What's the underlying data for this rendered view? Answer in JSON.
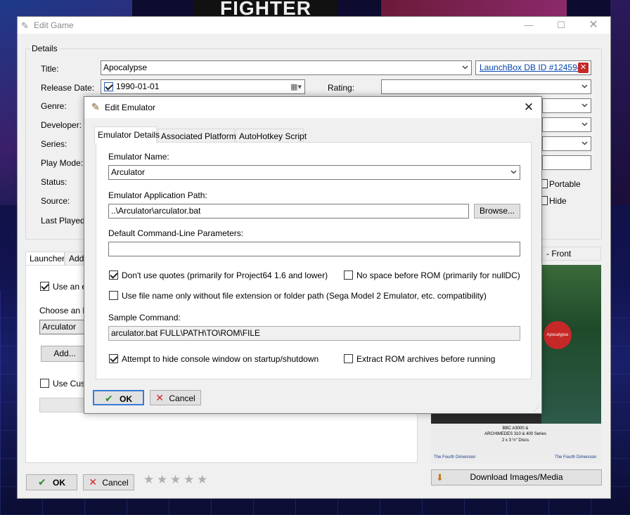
{
  "background": {
    "banner_text": "FIGHTER"
  },
  "edit_game": {
    "title": "Edit Game",
    "details_legend": "Details",
    "labels": {
      "title": "Title:",
      "release_date": "Release Date:",
      "genre": "Genre:",
      "developer": "Developer:",
      "series": "Series:",
      "play_mode": "Play Mode:",
      "status": "Status:",
      "source": "Source:",
      "last_played": "Last Played:",
      "rating": "Rating:"
    },
    "title_value": "Apocalypse",
    "release_date_value": "1990-01-01",
    "launchbox_link": "LaunchBox DB ID #124594",
    "portable_label": "Portable",
    "hide_label": "Hide",
    "tabs": [
      "Launcher",
      "Addi"
    ],
    "use_emulator_label": "Use an e",
    "choose_emulator_label": "Choose an E",
    "emulator_value": "Arculator",
    "add_button": "Add...",
    "use_custom_label": "Use Custo",
    "image_tab_label": "- Front",
    "box_art": {
      "bottom_line1": "BBC A3000 &",
      "bottom_line2": "ARCHIMEDES 310 & 400 Series",
      "bottom_line3": "2 x 3 ½\" Discs",
      "publisher": "The Fourth Dimension",
      "badge": "Apocalypse"
    },
    "download_button": "Download Images/Media",
    "ok_button": "OK",
    "cancel_button": "Cancel",
    "rating_stars": 0,
    "star_count": 5
  },
  "edit_emulator": {
    "title": "Edit Emulator",
    "tabs": [
      "Emulator Details",
      "Associated Platforms",
      "AutoHotkey Script"
    ],
    "emulator_name_label": "Emulator Name:",
    "emulator_name_value": "Arculator",
    "app_path_label": "Emulator Application Path:",
    "app_path_value": "..\\Arculator\\arculator.bat",
    "browse_button": "Browse...",
    "default_params_label": "Default Command-Line Parameters:",
    "default_params_value": "",
    "dont_use_quotes_label": "Don't use quotes (primarily for Project64 1.6 and lower)",
    "no_space_label": "No space before ROM (primarily for nullDC)",
    "file_name_only_label": "Use file name only without file extension or folder path (Sega Model 2 Emulator, etc. compatibility)",
    "sample_command_label": "Sample Command:",
    "sample_command_value": "arculator.bat FULL\\PATH\\TO\\ROM\\FILE",
    "hide_console_label": "Attempt to hide console window on startup/shutdown",
    "extract_rom_label": "Extract ROM archives before running",
    "ok_button": "OK",
    "cancel_button": "Cancel"
  }
}
